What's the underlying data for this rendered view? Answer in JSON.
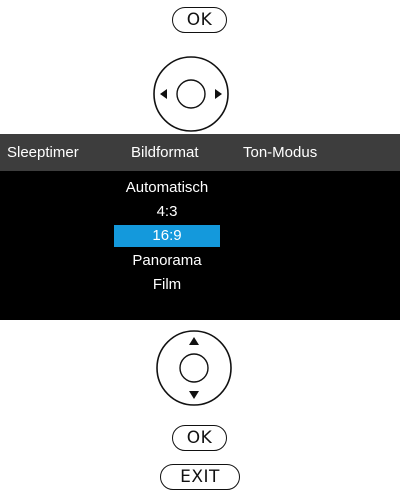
{
  "remote": {
    "ok_top_label": "OK",
    "ok_bottom_label": "OK",
    "exit_label": "EXIT",
    "dpad_left_right_icon": "dpad-left-right-icon",
    "dpad_up_down_icon": "dpad-up-down-icon"
  },
  "menu": {
    "tabs": [
      {
        "label": "Sleeptimer"
      },
      {
        "label": "Bildformat"
      },
      {
        "label": "Ton-Modus"
      }
    ],
    "options": [
      {
        "label": "Automatisch",
        "selected": false
      },
      {
        "label": "4:3",
        "selected": false
      },
      {
        "label": "16:9",
        "selected": true
      },
      {
        "label": "Panorama",
        "selected": false
      },
      {
        "label": "Film",
        "selected": false
      }
    ]
  },
  "colors": {
    "osd_background": "#000000",
    "menu_bar": "#3d3d3d",
    "selection_highlight": "#1499dc",
    "text": "#ffffff"
  }
}
